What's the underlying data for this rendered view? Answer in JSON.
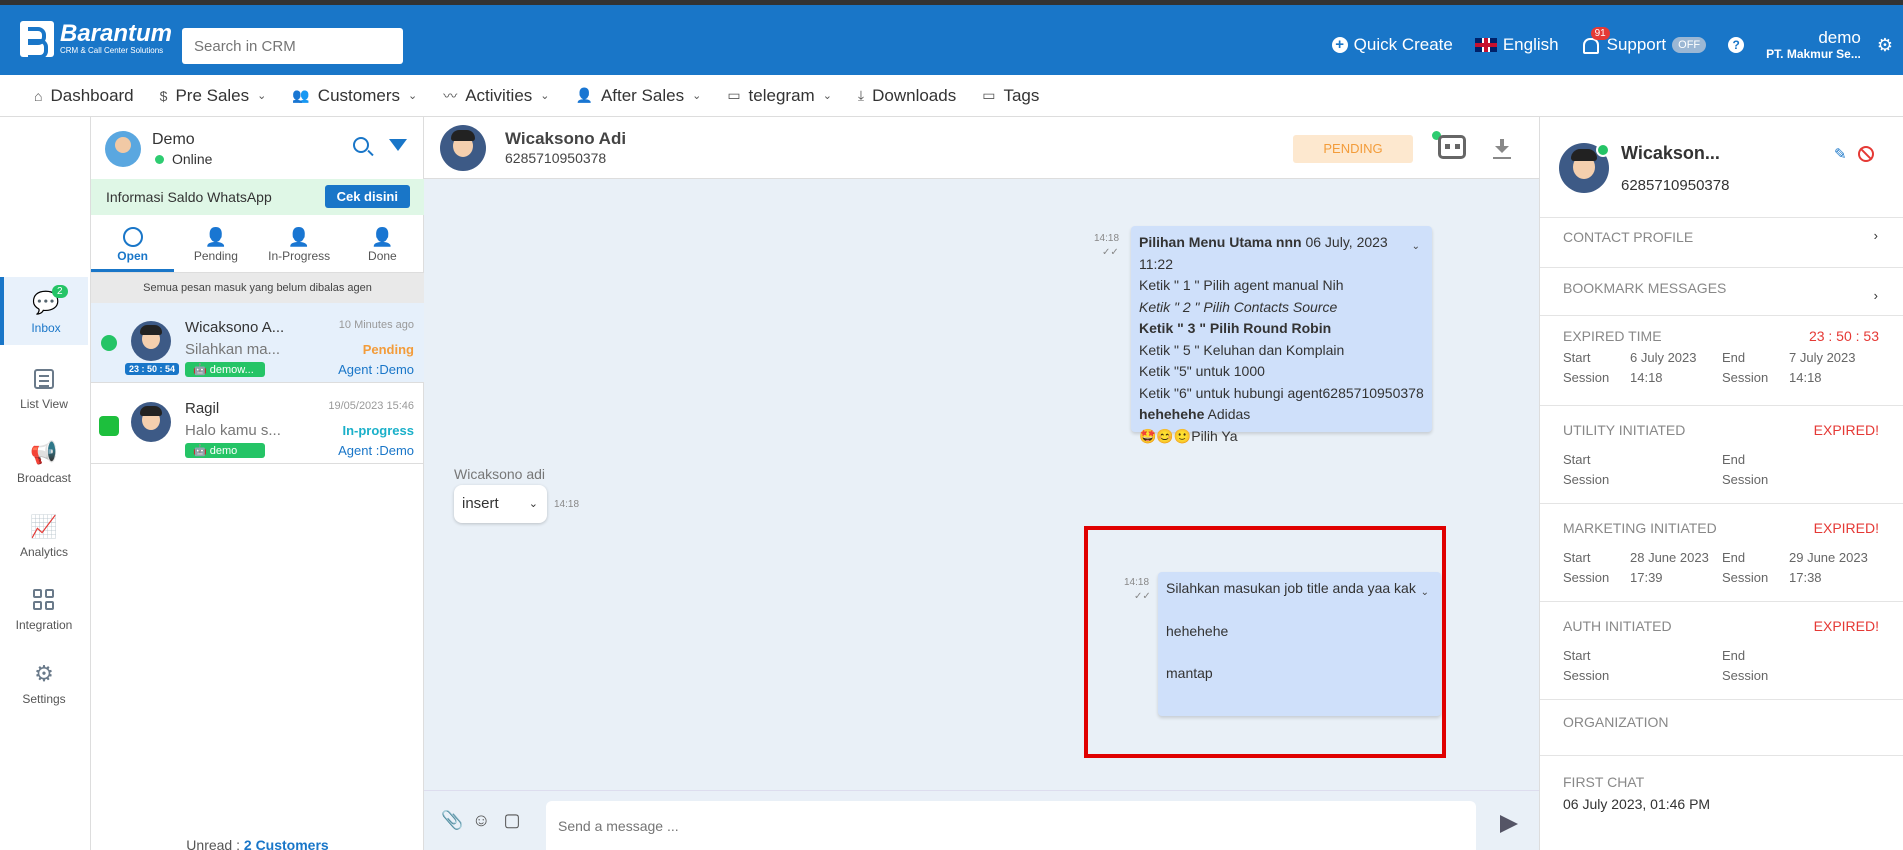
{
  "topbar": {
    "logo_title": "Barantum",
    "logo_subtitle": "CRM & Call Center Solutions",
    "search_placeholder": "Search in CRM",
    "quick_create": "Quick Create",
    "language": "English",
    "notifications_count": "91",
    "support": "Support",
    "support_toggle": "OFF",
    "help_icon": "?",
    "user_name": "demo",
    "user_org": "PT. Makmur Se...",
    "brand_color": "#1976c8"
  },
  "nav": {
    "items": [
      {
        "label": "Dashboard",
        "icon": "home-icon",
        "dropdown": false
      },
      {
        "label": "Pre Sales",
        "icon": "dollar-icon",
        "dropdown": true
      },
      {
        "label": "Customers",
        "icon": "users-icon",
        "dropdown": true
      },
      {
        "label": "Activities",
        "icon": "pulse-icon",
        "dropdown": true
      },
      {
        "label": "After Sales",
        "icon": "user-icon",
        "dropdown": true
      },
      {
        "label": "telegram",
        "icon": "folder-icon",
        "dropdown": true
      },
      {
        "label": "Downloads",
        "icon": "download-icon",
        "dropdown": false
      },
      {
        "label": "Tags",
        "icon": "folder-icon",
        "dropdown": false
      }
    ]
  },
  "rail": {
    "inbox": "Inbox",
    "inbox_badge": "2",
    "list_view": "List View",
    "broadcast": "Broadcast",
    "analytics": "Analytics",
    "integration": "Integration",
    "settings": "Settings"
  },
  "convlist": {
    "agent_name": "Demo",
    "agent_status": "Online",
    "wa_saldo": "Informasi Saldo WhatsApp",
    "cek_button": "Cek disini",
    "tabs": [
      "Open",
      "Pending",
      "In-Progress",
      "Done"
    ],
    "notice": "Semua pesan masuk yang belum dibalas agen",
    "conversations": [
      {
        "name": "Wicaksono A...",
        "snippet": "Silahkan ma...",
        "time": "10 Minutes ago",
        "state": "Pending",
        "state_color": "#f39c3a",
        "agent": "Agent :Demo",
        "tag": "demow...",
        "timer": "23 : 50 : 54",
        "channel": "whatsapp"
      },
      {
        "name": "Ragil",
        "snippet": "Halo kamu s...",
        "time": "19/05/2023 15:46",
        "state": "In-progress",
        "state_color": "#1ab0c9",
        "agent": "Agent :Demo",
        "tag": "demo",
        "channel": "line"
      }
    ],
    "unread_label": "Unread :",
    "unread_value": "2 Customers"
  },
  "chat": {
    "contact_name": "Wicaksono Adi",
    "contact_phone": "6285710950378",
    "status": "PENDING",
    "msg1": {
      "time": "14:18",
      "header_bold": "Pilihan Menu Utama nnn",
      "header_date": "06 July, 2023 11:22",
      "lines": [
        "Ketik \" 1 \" Pilih agent manual Nih",
        "Ketik \" 2 \" Pilih Contacts Source",
        "Ketik \" 3 \" Pilih Round Robin",
        "Ketik \" 5 \" Keluhan dan Komplain",
        "Ketik \"5\" untuk 1000",
        "Ketik \"6\" untuk hubungi agent6285710950378",
        "Adidas",
        "Pilih Ya"
      ],
      "bold_word": "hehehehe",
      "emojis": "🤩😊🙂"
    },
    "msg2": {
      "sender": "Wicaksono adi",
      "value": "insert",
      "time": "14:18"
    },
    "msg3": {
      "time": "14:18",
      "lines": [
        "Silahkan masukan job title anda yaa kak",
        "hehehehe",
        "mantap"
      ]
    },
    "composer_placeholder": "Send a message ..."
  },
  "rpanel": {
    "name": "Wicakson...",
    "phone": "6285710950378",
    "contact_profile": "CONTACT PROFILE",
    "bookmark": "BOOKMARK MESSAGES",
    "expired_time": "EXPIRED TIME",
    "expired_timer": "23 : 50 : 53",
    "start_session": "Start Session",
    "end_session": "End Session",
    "start_val_1": "6 July 2023 14:18",
    "end_val_1": "7 July 2023 14:18",
    "utility": "UTILITY INITIATED",
    "marketing": "MARKETING INITIATED",
    "start_val_m": "28 June 2023 17:39",
    "end_val_m": "29 June 2023 17:38",
    "auth": "AUTH INITIATED",
    "expired_label": "EXPIRED!",
    "organization": "ORGANIZATION",
    "first_chat": "FIRST CHAT",
    "first_chat_val": "06 July 2023, 01:46 PM"
  }
}
